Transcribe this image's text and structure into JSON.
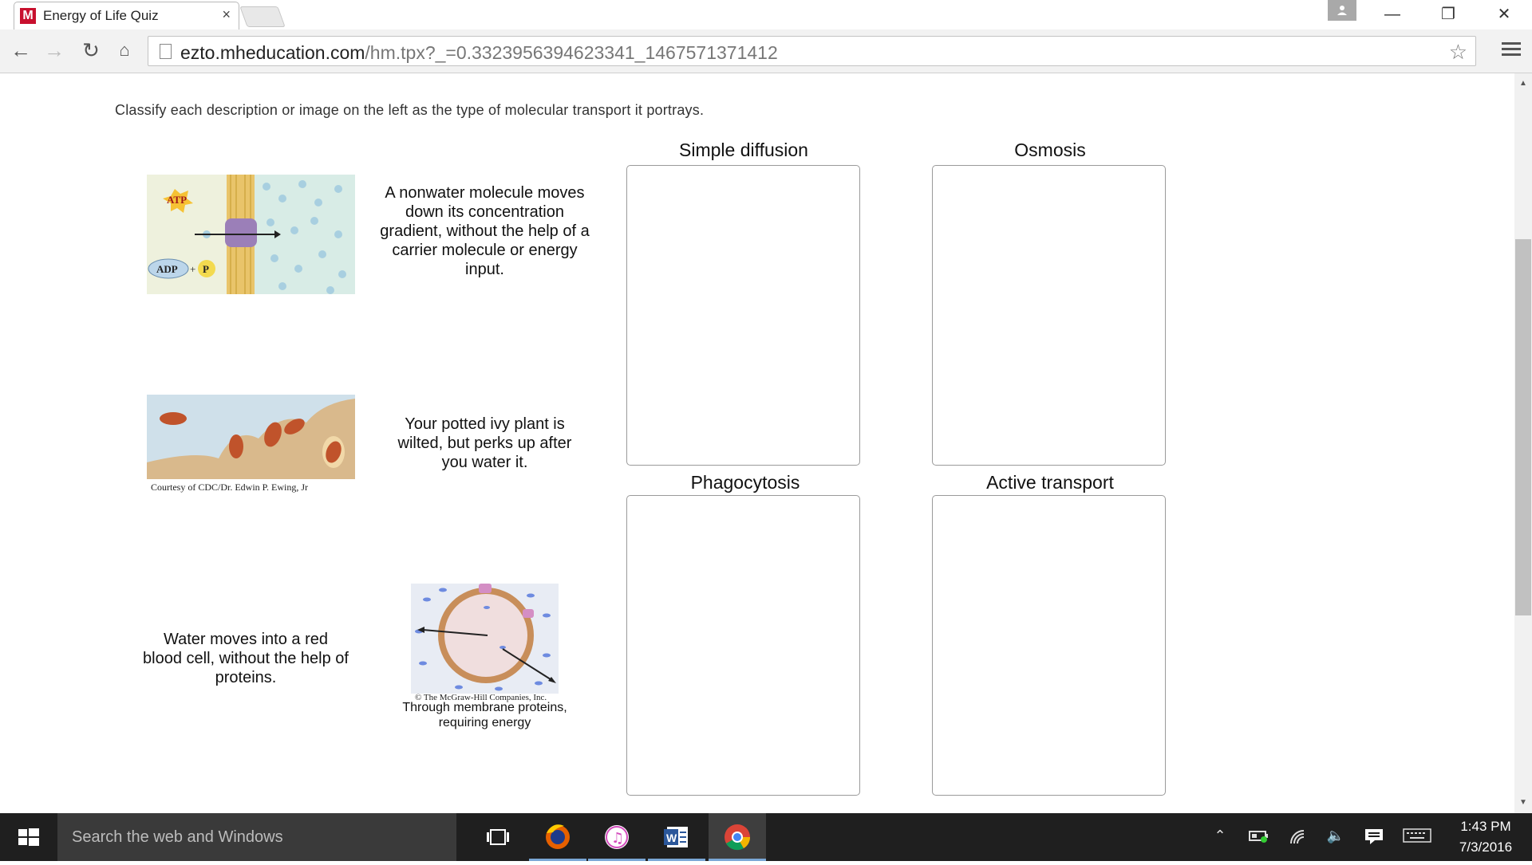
{
  "browser": {
    "tab_title": "Energy of Life Quiz",
    "tab_favicon": "M",
    "tab_close": "×",
    "url_host": "ezto.mheducation.com",
    "url_path": "/hm.tpx?_=0.3323956394623341_1467571371412",
    "window_controls": {
      "minimize": "—",
      "maximize": "❐",
      "close": "✕"
    }
  },
  "quiz": {
    "instructions": "Classify each description or image on the left as the type of molecular transport it portrays.",
    "items": {
      "atp_image_labels": {
        "atp": "ATP",
        "adp": "ADP",
        "plus": "+",
        "p": "P"
      },
      "desc_nonwater": "A nonwater molecule moves down its concentration gradient, without the help of a carrier molecule or energy input.",
      "photo_caption": "Courtesy of CDC/Dr. Edwin P. Ewing, Jr",
      "desc_ivy": "Your potted ivy plant is wilted, but perks up after you water it.",
      "desc_redcell": "Water moves into a red blood cell, without the help of proteins.",
      "cell_caption": "© The McGraw-Hill Companies, Inc.",
      "desc_membrane": "Through membrane proteins, requiring energy"
    },
    "zones": {
      "simple_diffusion": "Simple diffusion",
      "osmosis": "Osmosis",
      "phagocytosis": "Phagocytosis",
      "active_transport": "Active transport"
    }
  },
  "taskbar": {
    "search_placeholder": "Search the web and Windows",
    "time": "1:43 PM",
    "date": "7/3/2016",
    "apps": [
      "task-view-icon",
      "firefox-icon",
      "itunes-icon",
      "word-icon",
      "chrome-icon"
    ]
  }
}
